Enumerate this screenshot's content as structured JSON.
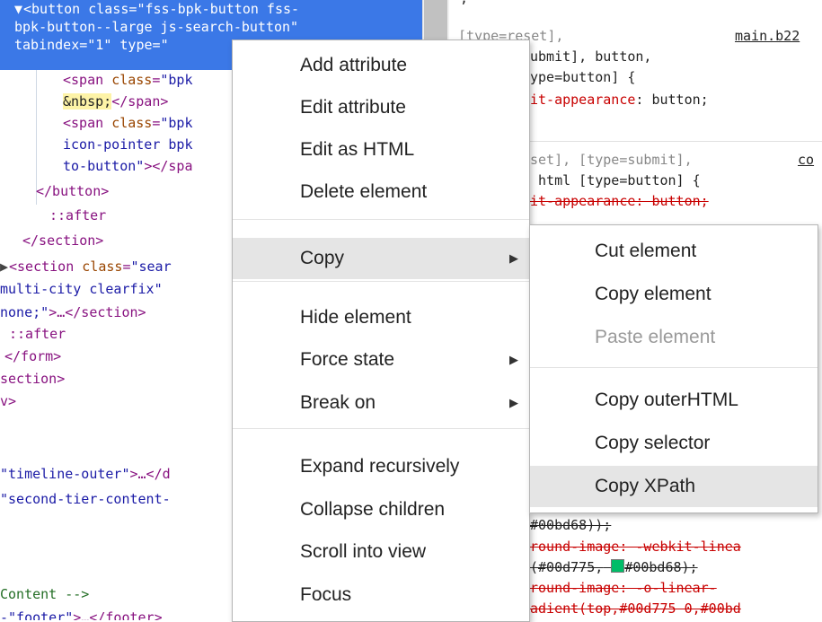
{
  "elements": {
    "lines": [
      {
        "parts": [
          [
            "tri",
            "▼ "
          ],
          [
            "tag",
            "<button "
          ],
          [
            "attr",
            "class"
          ],
          [
            "tag",
            "="
          ],
          [
            "val",
            "\"fss-bpk-button fss-"
          ]
        ]
      },
      {
        "parts": [
          [
            "val",
            "bpk-button--large js-search-button\""
          ]
        ]
      },
      {
        "parts": [
          [
            "attr",
            "tabindex"
          ],
          [
            "tag",
            "="
          ],
          [
            "val",
            "\"1\""
          ],
          [
            "attr",
            " type"
          ],
          [
            "tag",
            "="
          ],
          [
            "val",
            "\""
          ]
        ]
      },
      {
        "parts": [
          [
            "tag",
            "<span "
          ],
          [
            "attr",
            "class"
          ],
          [
            "tag",
            "="
          ],
          [
            "val",
            "\"bpk"
          ]
        ]
      },
      {
        "parts": [
          [
            "txt",
            "&nbsp;"
          ],
          [
            "tag",
            "</span>"
          ]
        ]
      },
      {
        "parts": [
          [
            "tag",
            "<span "
          ],
          [
            "attr",
            "class"
          ],
          [
            "tag",
            "="
          ],
          [
            "val",
            "\"bpk"
          ]
        ]
      },
      {
        "parts": [
          [
            "val",
            "icon-pointer bpk"
          ]
        ]
      },
      {
        "parts": [
          [
            "val",
            "to-button\""
          ],
          [
            "tag",
            "></spa"
          ]
        ]
      },
      {
        "parts": [
          [
            "tag",
            "</button>"
          ]
        ]
      },
      {
        "parts": [
          [
            "pseudo",
            "::after"
          ]
        ]
      },
      {
        "parts": [
          [
            "tag",
            "</section>"
          ]
        ]
      },
      {
        "parts": [
          [
            "tri",
            "▶"
          ],
          [
            "tag",
            "<section "
          ],
          [
            "attr",
            "class"
          ],
          [
            "tag",
            "="
          ],
          [
            "val",
            "\"sear"
          ]
        ]
      },
      {
        "parts": [
          [
            "val",
            "multi-city clearfix\""
          ]
        ]
      },
      {
        "parts": [
          [
            "val",
            "none;\""
          ],
          [
            "tag",
            ">…</section>"
          ]
        ]
      },
      {
        "parts": [
          [
            "pseudo",
            "::after"
          ]
        ]
      },
      {
        "parts": [
          [
            "tag",
            "</form>"
          ]
        ]
      },
      {
        "parts": [
          [
            "tag",
            "section>"
          ]
        ]
      },
      {
        "parts": [
          [
            "tag",
            "v>"
          ]
        ]
      },
      {
        "parts": [
          [
            "val",
            "\"timeline-outer\""
          ],
          [
            "tag",
            ">…</d"
          ]
        ]
      },
      {
        "parts": [
          [
            "val",
            "\"second-tier-content-"
          ]
        ]
      },
      {
        "parts": [
          [
            "cmt",
            "Content -->"
          ]
        ]
      },
      {
        "parts": [
          [
            "val",
            "-\"footer\""
          ],
          [
            "tag",
            ">…</footer>"
          ]
        ]
      }
    ]
  },
  "styles": {
    "top_char": ",",
    "rule1_sel1": "[type=reset],",
    "rule1_source": "main.b22",
    "rule1_sel2": "ubmit], button,",
    "rule1_sel3": "ype=button] {",
    "rule1_prop": "it-appearance",
    "rule1_value": ": button;",
    "rule2_sel1": "set], [type=submit],",
    "rule2_source": "co",
    "rule2_sel2": " html [type=button] {",
    "rule2_prop": "it-appearance: button;",
    "bottom1": "#00bd68));",
    "bottom2": "round-image: -webkit-linea",
    "bottom3a": "(#00d775,",
    "bottom3b": "#00bd68);",
    "bottom4": "round-image: -o-linear-",
    "bottom5": "adient(top,#00d775 0,#00bd"
  },
  "context_menu": {
    "items": [
      {
        "label": "Add attribute"
      },
      {
        "label": "Edit attribute"
      },
      {
        "label": "Edit as HTML"
      },
      {
        "label": "Delete element"
      },
      {
        "label": "Copy",
        "submenu": true
      },
      {
        "label": "Hide element"
      },
      {
        "label": "Force state",
        "submenu": true
      },
      {
        "label": "Break on",
        "submenu": true
      },
      {
        "label": "Expand recursively"
      },
      {
        "label": "Collapse children"
      },
      {
        "label": "Scroll into view"
      },
      {
        "label": "Focus"
      }
    ]
  },
  "copy_submenu": {
    "items": [
      {
        "label": "Cut element"
      },
      {
        "label": "Copy element"
      },
      {
        "label": "Paste element",
        "disabled": true
      },
      {
        "label": "Copy outerHTML"
      },
      {
        "label": "Copy selector"
      },
      {
        "label": "Copy XPath",
        "hover": true
      }
    ]
  },
  "icons": {
    "submenu_arrow": "chevron-right-icon",
    "expand_triangle": "triangle-down-icon",
    "collapsed_triangle": "triangle-right-icon"
  },
  "colors": {
    "selection": "#3b78e7",
    "tag": "#881280",
    "attribute": "#994500",
    "value": "#1a1aa6",
    "swatch": "#00bd68"
  }
}
